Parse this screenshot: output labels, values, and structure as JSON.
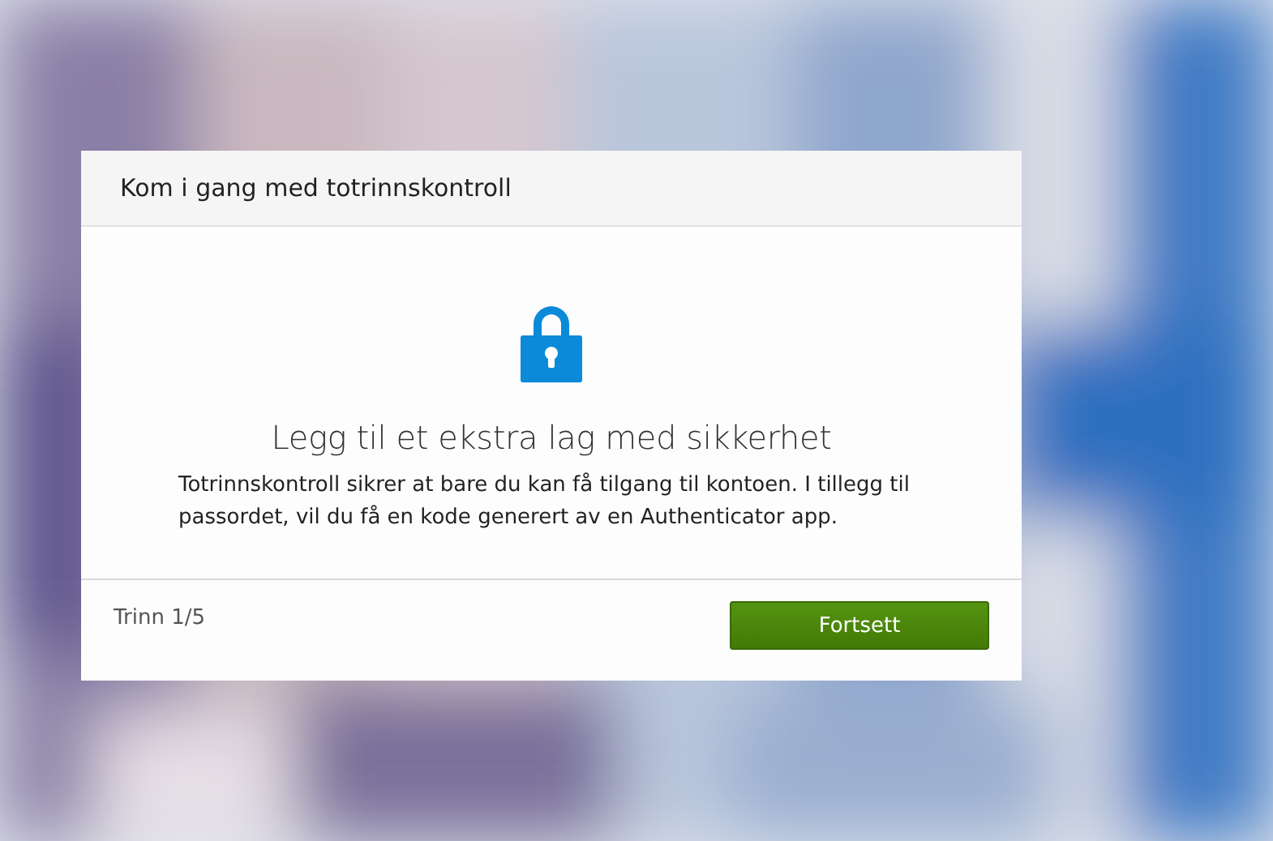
{
  "dialog": {
    "title": "Kom i gang med totrinnskontroll",
    "heading": "Legg til et ekstra lag med sikkerhet",
    "description": "Totrinnskontroll sikrer at bare du kan få tilgang til kontoen. I tillegg til passordet, vil du få en kode generert av en Authenticator app.",
    "step": "Trinn 1/5",
    "button": "Fortsett"
  }
}
